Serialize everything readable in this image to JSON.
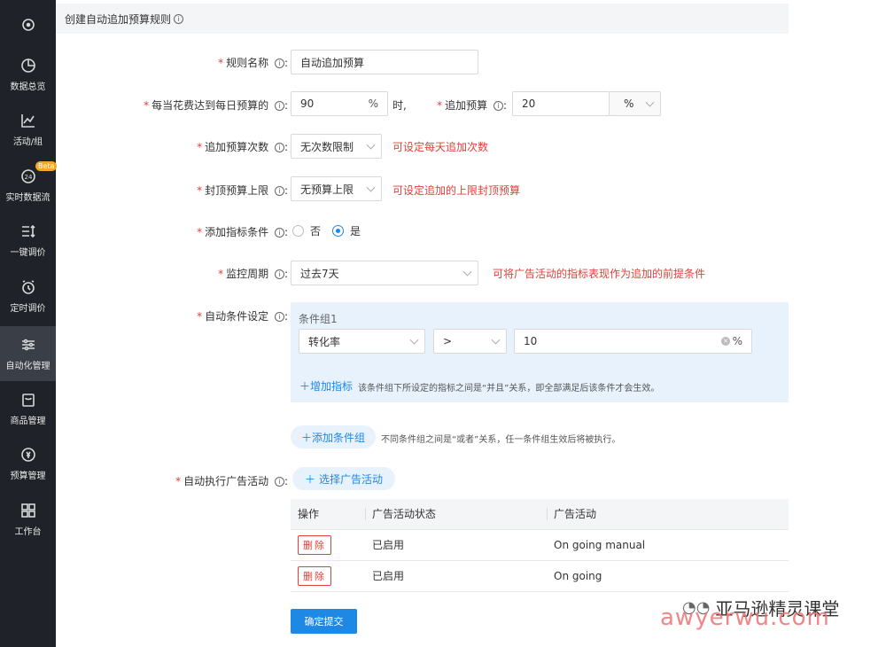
{
  "sidebar": {
    "items": [
      {
        "label": "",
        "icon": "circle-dot-icon"
      },
      {
        "label": "数据总览",
        "icon": "pie-chart-icon"
      },
      {
        "label": "活动/组",
        "icon": "line-chart-icon"
      },
      {
        "label": "实时数据流",
        "icon": "24h-icon",
        "badge": "Beta"
      },
      {
        "label": "一键调价",
        "icon": "sort-list-icon"
      },
      {
        "label": "定时调价",
        "icon": "alarm-clock-icon"
      },
      {
        "label": "自动化管理",
        "icon": "sliders-icon"
      },
      {
        "label": "商品管理",
        "icon": "bag-icon"
      },
      {
        "label": "预算管理",
        "icon": "budget-icon"
      },
      {
        "label": "工作台",
        "icon": "grid-icon"
      }
    ]
  },
  "header": {
    "title": "创建自动追加预算规则"
  },
  "form": {
    "rule_name": {
      "label": "规则名称",
      "value": "自动追加预算"
    },
    "spend_threshold": {
      "label": "每当花费达到每日预算的",
      "value": "90",
      "suffix": "%",
      "after": "时,"
    },
    "add_budget": {
      "label": "追加预算",
      "value": "20",
      "unit": "%"
    },
    "add_times": {
      "label": "追加预算次数",
      "value": "无次数限制",
      "note": "可设定每天追加次数"
    },
    "cap": {
      "label": "封顶预算上限",
      "value": "无预算上限",
      "note": "可设定追加的上限封顶预算"
    },
    "add_condition": {
      "label": "添加指标条件",
      "option_no": "否",
      "option_yes": "是",
      "selected": "是"
    },
    "period": {
      "label": "监控周期",
      "value": "过去7天",
      "note": "可将广告活动的指标表现作为追加的前提条件"
    },
    "auto_cond": {
      "label": "自动条件设定",
      "group_title": "条件组1",
      "metric": "转化率",
      "operator": ">",
      "threshold": "10",
      "unit": "%",
      "add_metric": "增加指标",
      "add_metric_hint": "该条件组下所设定的指标之间是“并且”关系，即全部满足后该条件才会生效。",
      "add_group": "添加条件组",
      "add_group_hint": "不同条件组之间是“或者”关系，任一条件组生效后将被执行。"
    },
    "campaigns": {
      "label": "自动执行广告活动",
      "select_btn": "选择广告活动",
      "columns": [
        "操作",
        "广告活动状态",
        "广告活动"
      ],
      "rows": [
        {
          "action": "删除",
          "status": "已启用",
          "name": "On going manual"
        },
        {
          "action": "删除",
          "status": "已启用",
          "name": "On going"
        }
      ]
    },
    "submit": "确定提交"
  },
  "watermark": {
    "cn": "亚马逊精灵课堂",
    "en": "awyerwu.com"
  }
}
